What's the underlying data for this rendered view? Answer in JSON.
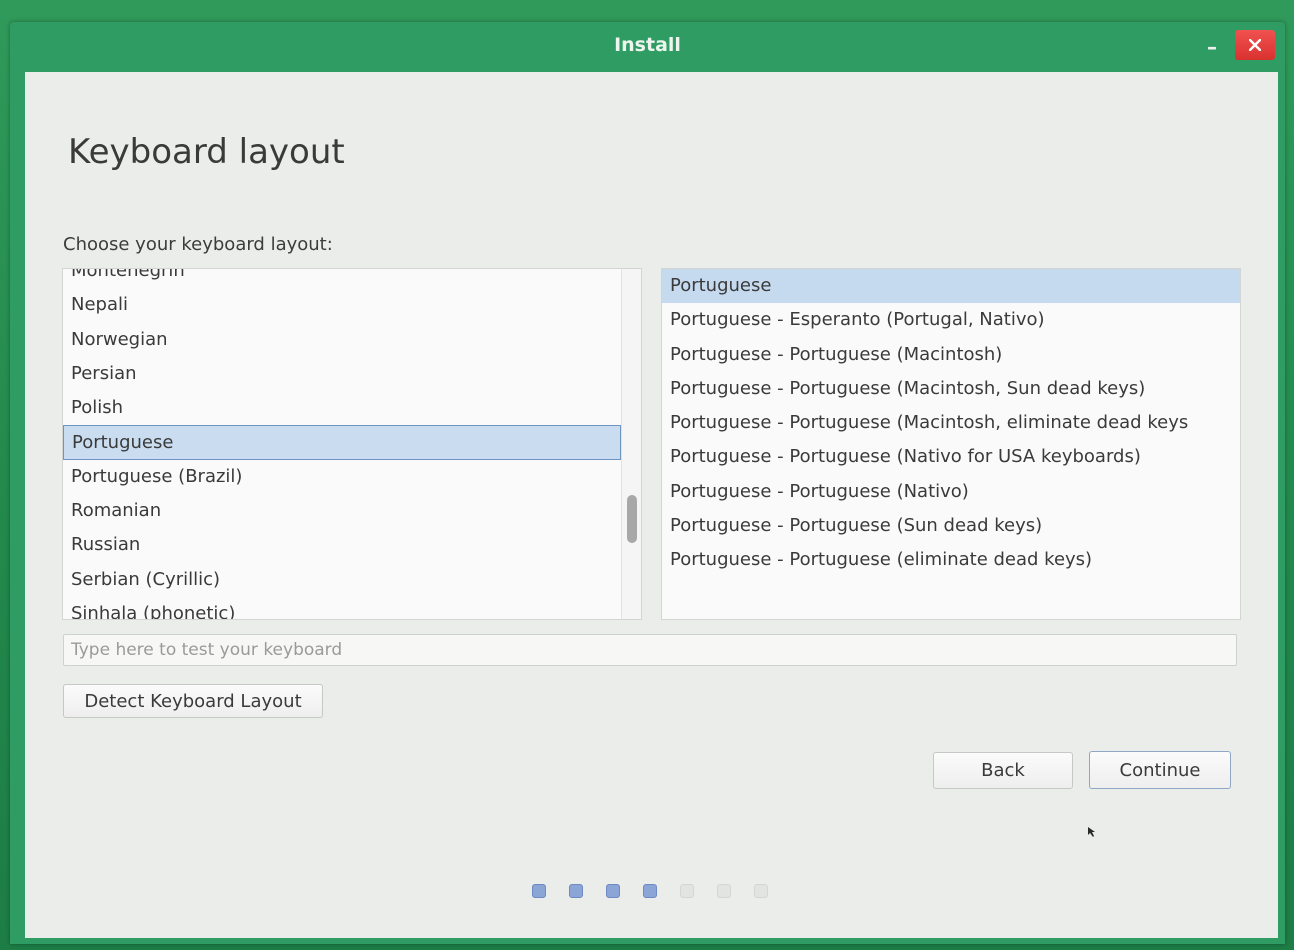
{
  "window": {
    "title": "Install"
  },
  "page": {
    "heading": "Keyboard layout",
    "choose_label": "Choose your keyboard layout:"
  },
  "layouts": {
    "items": [
      "Montenegrin",
      "Nepali",
      "Norwegian",
      "Persian",
      "Polish",
      "Portuguese",
      "Portuguese (Brazil)",
      "Romanian",
      "Russian",
      "Serbian (Cyrillic)",
      "Sinhala (phonetic)"
    ],
    "selected": "Portuguese"
  },
  "variants": {
    "items": [
      "Portuguese",
      "Portuguese - Esperanto (Portugal, Nativo)",
      "Portuguese - Portuguese (Macintosh)",
      "Portuguese - Portuguese (Macintosh, Sun dead keys)",
      "Portuguese - Portuguese (Macintosh, eliminate dead keys",
      "Portuguese - Portuguese (Nativo for USA keyboards)",
      "Portuguese - Portuguese (Nativo)",
      "Portuguese - Portuguese (Sun dead keys)",
      "Portuguese - Portuguese (eliminate dead keys)"
    ],
    "selected": "Portuguese"
  },
  "test_field": {
    "value": "",
    "placeholder": "Type here to test your keyboard"
  },
  "buttons": {
    "detect": "Detect Keyboard Layout",
    "back": "Back",
    "continue": "Continue"
  },
  "progress": {
    "completed_steps": 4,
    "total_steps": 7
  },
  "colors": {
    "titlebar": "#2e9c63",
    "close_button": "#e0413d",
    "selection": "#c9dcf0",
    "progress_done": "#8aa5d6"
  }
}
